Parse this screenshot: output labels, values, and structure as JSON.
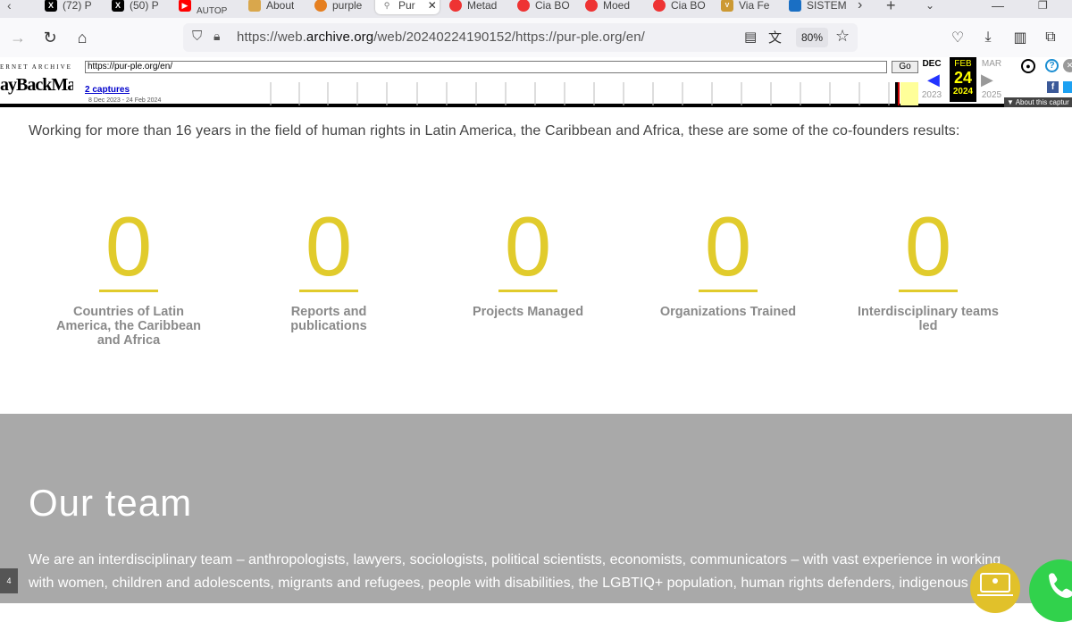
{
  "browser": {
    "tabs": [
      {
        "label": "(72) P",
        "icon": "x-icon"
      },
      {
        "label": "(50) P",
        "icon": "x-icon"
      },
      {
        "label": "AUTOP",
        "icon": "youtube-icon"
      },
      {
        "label": "About",
        "icon": "cookie-icon"
      },
      {
        "label": "purple",
        "icon": "site-icon"
      },
      {
        "label": "Pur",
        "icon": "purple-icon"
      },
      {
        "label": "Metad",
        "icon": "opera-icon"
      },
      {
        "label": "Cia BO",
        "icon": "opera-icon"
      },
      {
        "label": "Moed",
        "icon": "opera-icon"
      },
      {
        "label": "Cia BO",
        "icon": "opera-icon"
      },
      {
        "label": "Via Fe",
        "icon": "via-icon"
      },
      {
        "label": "SISTEM",
        "icon": "sistem-icon"
      }
    ],
    "url_prefix": "https://web.",
    "url_domain": "archive.org",
    "url_suffix": "/web/20240224190152/https://pur-ple.org/en/",
    "zoom": "80%"
  },
  "wayback": {
    "archive_label": "ERNET ARCHIVE",
    "logo_a": "ayBack",
    "logo_b": "Machine",
    "url_value": "https://pur-ple.org/en/",
    "go_label": "Go",
    "captures": "2 captures",
    "range": "8 Dec 2023 - 24 Feb 2024",
    "prev_month": "DEC",
    "cur_month": "FEB",
    "next_month": "MAR",
    "day": "24",
    "prev_year": "2023",
    "cur_year": "2024",
    "next_year": "2025",
    "about": "About this captur"
  },
  "page": {
    "intro": "Working for more than 16 years in the field of human rights in Latin America, the Caribbean and Africa, these are some of the co-founders results:",
    "stats": [
      {
        "value": "0",
        "label": "Countries of Latin America, the Caribbean and Africa"
      },
      {
        "value": "0",
        "label": "Reports and publications"
      },
      {
        "value": "0",
        "label": "Projects Managed"
      },
      {
        "value": "0",
        "label": "Organizations Trained"
      },
      {
        "value": "0",
        "label": "Interdisciplinary teams led"
      }
    ],
    "team_title": "Our team",
    "team_text": "We are an interdisciplinary team – anthropologists, lawyers, sociologists, political scientists, economists, communicators – with vast experience in working with women, children and adolescents, migrants and refugees, people with disabilities, the LGBTIQ+ population, human rights defenders, indigenous"
  },
  "colors": {
    "accent": "#e1cb2c",
    "team_bg": "#a9a9a9",
    "whatsapp": "#31d24c"
  }
}
